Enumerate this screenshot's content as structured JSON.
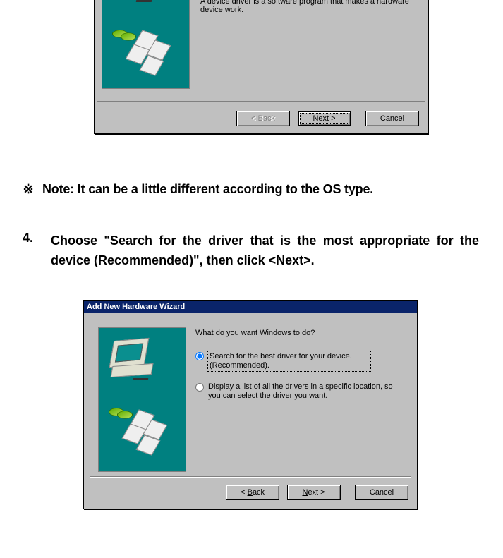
{
  "wizard1": {
    "body_text": "A device driver is a software program that makes a hardware device work.",
    "buttons": {
      "back": "< Back",
      "next": "Next >",
      "cancel": "Cancel"
    }
  },
  "note": {
    "bullet": "※",
    "text": "Note: It can be a little different according to the OS type."
  },
  "step4": {
    "num": "4.",
    "text": "Choose \"Search for the driver that is the most appropriate for the device (Recommended)\", then click <Next>."
  },
  "wizard2": {
    "title": "Add New Hardware Wizard",
    "prompt": "What do you want Windows to do?",
    "options": {
      "search": "Search for the best driver for your device. (Recommended).",
      "list": "Display a list of all the drivers in a specific location, so you can select the driver you want."
    },
    "selected": "search",
    "buttons": {
      "back_pre": "< ",
      "back_u": "B",
      "back_post": "ack",
      "next_pre": "",
      "next_u": "N",
      "next_post": "ext >",
      "cancel": "Cancel"
    }
  }
}
